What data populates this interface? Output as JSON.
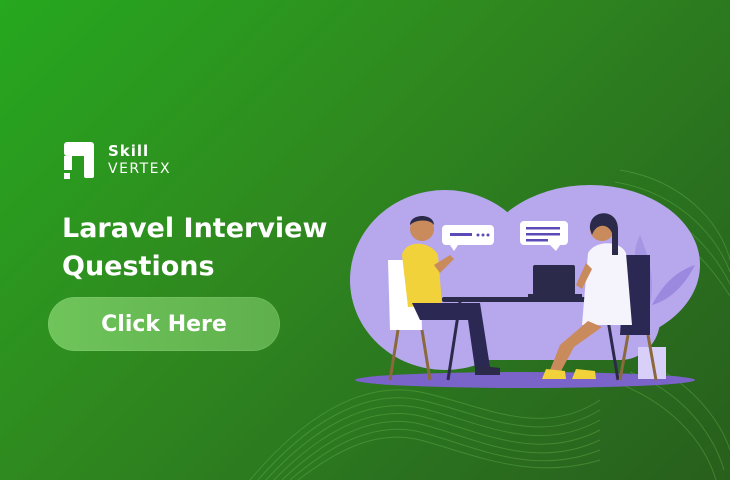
{
  "brand": {
    "name_top": "Skill",
    "name_bottom": "VERTEX",
    "colors": {
      "background_start": "#26a81f",
      "background_end": "#285f1c",
      "accent": "#b7a8ee",
      "button": "#6fc45a"
    }
  },
  "headline": {
    "lines": [
      "Laravel Interview",
      "Questions"
    ]
  },
  "cta": {
    "label": "Click Here"
  },
  "illustration": {
    "subject": "interview-scene",
    "icons": [
      "speech-bubble-icon",
      "laptop-icon",
      "plant-icon"
    ]
  }
}
